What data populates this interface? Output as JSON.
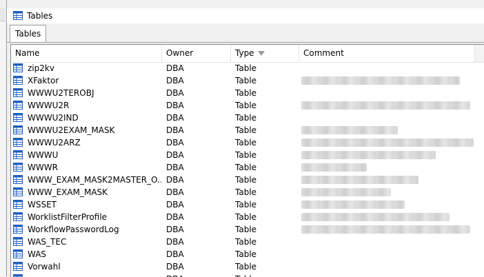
{
  "window": {
    "title": "Tables"
  },
  "tabs": [
    {
      "label": "Tables"
    }
  ],
  "columns": {
    "name": "Name",
    "owner": "Owner",
    "type": "Type",
    "comment": "Comment"
  },
  "rows": [
    {
      "name": "zip2kv",
      "owner": "DBA",
      "type": "Table",
      "comment_redacted": false
    },
    {
      "name": "XFaktor",
      "owner": "DBA",
      "type": "Table",
      "comment_redacted": true
    },
    {
      "name": "WWWU2TEROBJ",
      "owner": "DBA",
      "type": "Table",
      "comment_redacted": false
    },
    {
      "name": "WWWU2R",
      "owner": "DBA",
      "type": "Table",
      "comment_redacted": true
    },
    {
      "name": "WWWU2IND",
      "owner": "DBA",
      "type": "Table",
      "comment_redacted": false
    },
    {
      "name": "WWWU2EXAM_MASK",
      "owner": "DBA",
      "type": "Table",
      "comment_redacted": true
    },
    {
      "name": "WWWU2ARZ",
      "owner": "DBA",
      "type": "Table",
      "comment_redacted": true
    },
    {
      "name": "WWWU",
      "owner": "DBA",
      "type": "Table",
      "comment_redacted": true
    },
    {
      "name": "WWWR",
      "owner": "DBA",
      "type": "Table",
      "comment_redacted": true
    },
    {
      "name": "WWW_EXAM_MASK2MASTER_O...",
      "owner": "DBA",
      "type": "Table",
      "comment_redacted": true
    },
    {
      "name": "WWW_EXAM_MASK",
      "owner": "DBA",
      "type": "Table",
      "comment_redacted": true
    },
    {
      "name": "WSSET",
      "owner": "DBA",
      "type": "Table",
      "comment_redacted": true
    },
    {
      "name": "WorklistFilterProfile",
      "owner": "DBA",
      "type": "Table",
      "comment_redacted": true
    },
    {
      "name": "WorkflowPasswordLog",
      "owner": "DBA",
      "type": "Table",
      "comment_redacted": true
    },
    {
      "name": "WAS_TEC",
      "owner": "DBA",
      "type": "Table",
      "comment_redacted": false
    },
    {
      "name": "WAS",
      "owner": "DBA",
      "type": "Table",
      "comment_redacted": false
    },
    {
      "name": "Vorwahl",
      "owner": "DBA",
      "type": "Table",
      "comment_redacted": false
    },
    {
      "name": "",
      "owner": "DBA",
      "type": "Table",
      "comment_redacted": false
    }
  ],
  "icons": {
    "window": "table-icon",
    "row": "table-icon",
    "sort": "sort-descending-icon"
  },
  "colors": {
    "icon_blue": "#1f5fbf",
    "grid_border": "#828790"
  }
}
